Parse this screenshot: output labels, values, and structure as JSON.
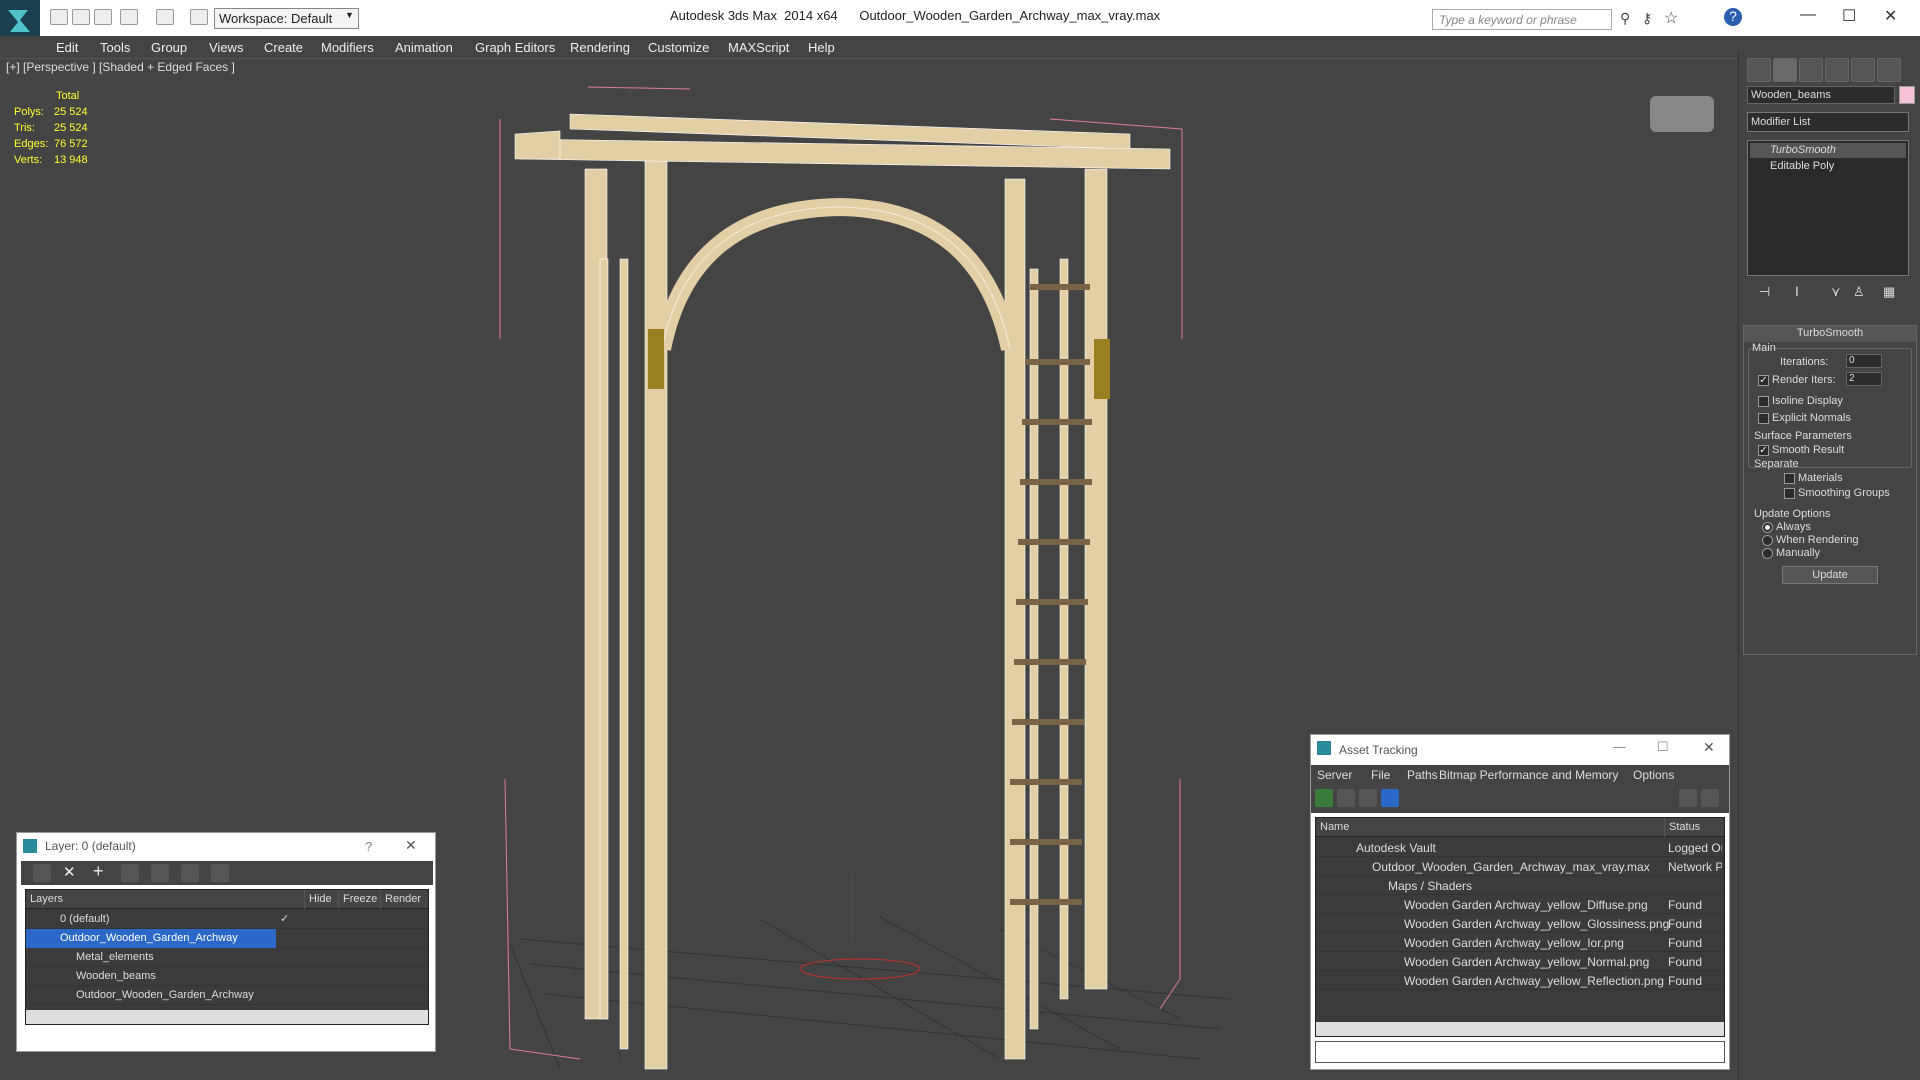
{
  "app": {
    "title": "Autodesk 3ds Max  2014 x64      Outdoor_Wooden_Garden_Archway_max_vray.max",
    "workspace_label": "Workspace: Default",
    "search_placeholder": "Type a keyword or phrase"
  },
  "menu": [
    "Edit",
    "Tools",
    "Group",
    "Views",
    "Create",
    "Modifiers",
    "Animation",
    "Graph Editors",
    "Rendering",
    "Customize",
    "MAXScript",
    "Help"
  ],
  "viewport": {
    "label": "[+] [Perspective ] [Shaded + Edged Faces ]",
    "stats": {
      "header": "Total",
      "rows": [
        {
          "label": "Polys:",
          "value": "25 524"
        },
        {
          "label": "Tris:",
          "value": "25 524"
        },
        {
          "label": "Edges:",
          "value": "76 572"
        },
        {
          "label": "Verts:",
          "value": "13 948"
        }
      ]
    }
  },
  "command_panel": {
    "object_name": "Wooden_beams",
    "object_color": "#f6c2d8",
    "modifier_list": "Modifier List",
    "stack": [
      "TurboSmooth",
      "Editable Poly"
    ],
    "rollout_title": "TurboSmooth",
    "main_label": "Main",
    "iterations_label": "Iterations:",
    "iterations_value": "0",
    "render_iters_label": "Render Iters:",
    "render_iters_value": "2",
    "render_iters_checked": true,
    "isoline_label": "Isoline Display",
    "explicit_label": "Explicit Normals",
    "surface_label": "Surface Parameters",
    "smooth_result_label": "Smooth Result",
    "separate_label": "Separate",
    "materials_label": "Materials",
    "smoothing_groups_label": "Smoothing Groups",
    "update_options_label": "Update Options",
    "always_label": "Always",
    "when_rendering_label": "When Rendering",
    "manually_label": "Manually",
    "update_button": "Update"
  },
  "layer_window": {
    "title": "Layer: 0 (default)",
    "help": "?",
    "columns": [
      "Layers",
      "Hide",
      "Freeze",
      "Render"
    ],
    "rows": [
      {
        "name": "0 (default)",
        "selected": false
      },
      {
        "name": "Outdoor_Wooden_Garden_Archway",
        "selected": true
      },
      {
        "name": "Metal_elements",
        "selected": false
      },
      {
        "name": "Wooden_beams",
        "selected": false
      },
      {
        "name": "Outdoor_Wooden_Garden_Archway",
        "selected": false
      }
    ]
  },
  "asset_tracking": {
    "title": "Asset Tracking",
    "menu": [
      "Server",
      "File",
      "Paths",
      "Bitmap Performance and Memory",
      "Options"
    ],
    "columns": [
      "Name",
      "Status"
    ],
    "rows": [
      {
        "name": "Autodesk Vault",
        "status": "Logged Ou"
      },
      {
        "name": "Outdoor_Wooden_Garden_Archway_max_vray.max",
        "status": "Network P"
      },
      {
        "name": "Maps / Shaders",
        "status": ""
      },
      {
        "name": "Wooden Garden Archway_yellow_Diffuse.png",
        "status": "Found"
      },
      {
        "name": "Wooden Garden Archway_yellow_Glossiness.png",
        "status": "Found"
      },
      {
        "name": "Wooden Garden Archway_yellow_Ior.png",
        "status": "Found"
      },
      {
        "name": "Wooden Garden Archway_yellow_Normal.png",
        "status": "Found"
      },
      {
        "name": "Wooden Garden Archway_yellow_Reflection.png",
        "status": "Found"
      }
    ]
  }
}
